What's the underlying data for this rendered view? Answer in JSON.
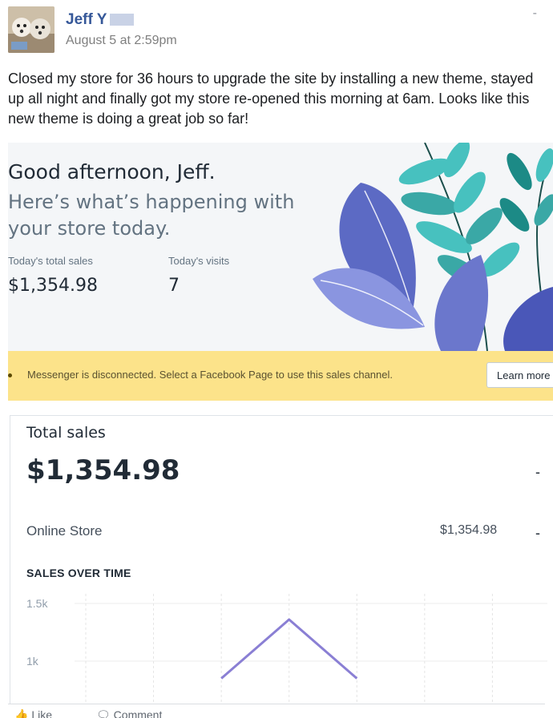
{
  "post": {
    "author": "Jeff Y",
    "timestamp": "August 5 at 2:59pm",
    "menu_glyph": "-",
    "body": "Closed my store for 36 hours to upgrade the site by installing a new theme, stayed up all night and finally got my store re-opened this morning at 6am. Looks like this new theme is doing a great job so far!"
  },
  "dashboard": {
    "greeting": "Good afternoon, Jeff.",
    "subgreeting": "Here’s what’s happening with your store today.",
    "metrics": [
      {
        "label": "Today's total sales",
        "value": "$1,354.98"
      },
      {
        "label": "Today's visits",
        "value": "7"
      }
    ],
    "banner": {
      "text": "Messenger is disconnected. Select a Facebook Page to use this sales channel.",
      "button": "Learn more"
    },
    "sales_card": {
      "title": "Total sales",
      "total": "$1,354.98",
      "total_trend": "-",
      "row_label": "Online Store",
      "row_value": "$1,354.98",
      "row_trend": "-",
      "chart_title": "SALES OVER TIME"
    },
    "colors": {
      "banner": "#fce38a",
      "chart_line": "#8a7fd4",
      "leaf_teal": "#47c1bf",
      "leaf_indigo": "#5c6ac4"
    }
  },
  "chart_data": {
    "type": "line",
    "title": "SALES OVER TIME",
    "y_ticks": [
      "1.5k",
      "1k"
    ],
    "ylim": [
      1000,
      1500
    ],
    "grid": true,
    "x_index": [
      0,
      1,
      2,
      3,
      4,
      5,
      6
    ],
    "series": [
      {
        "values": [
          null,
          null,
          850,
          1360,
          850,
          null,
          null
        ]
      }
    ]
  },
  "footer": {
    "like": "Like",
    "comment": "Comment"
  }
}
